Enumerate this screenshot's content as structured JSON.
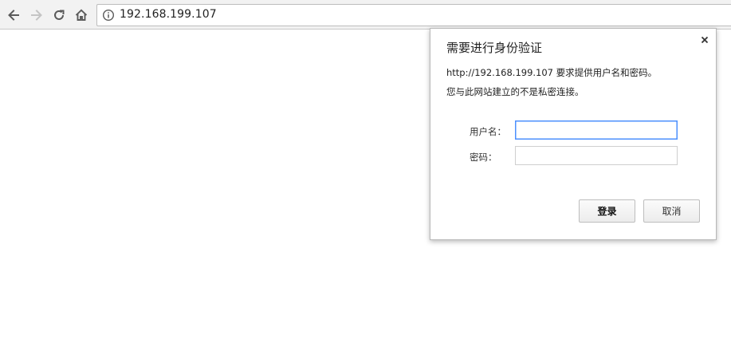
{
  "browser": {
    "address_bar": {
      "url": "192.168.199.107"
    },
    "icons": {
      "back": "back-arrow-icon",
      "forward": "forward-arrow-icon",
      "reload": "reload-icon",
      "home": "home-icon",
      "site_info": "info-icon"
    }
  },
  "auth_dialog": {
    "title": "需要进行身份验证",
    "message_line1": "http://192.168.199.107 要求提供用户名和密码。",
    "message_line2": "您与此网站建立的不是私密连接。",
    "username_label": "用户名：",
    "username_value": "",
    "password_label": "密码：",
    "password_value": "",
    "login_button": "登录",
    "cancel_button": "取消",
    "close_icon": "close-icon"
  },
  "colors": {
    "focus_border": "#4d90fe",
    "toolbar_bg": "#f2f2f2"
  }
}
